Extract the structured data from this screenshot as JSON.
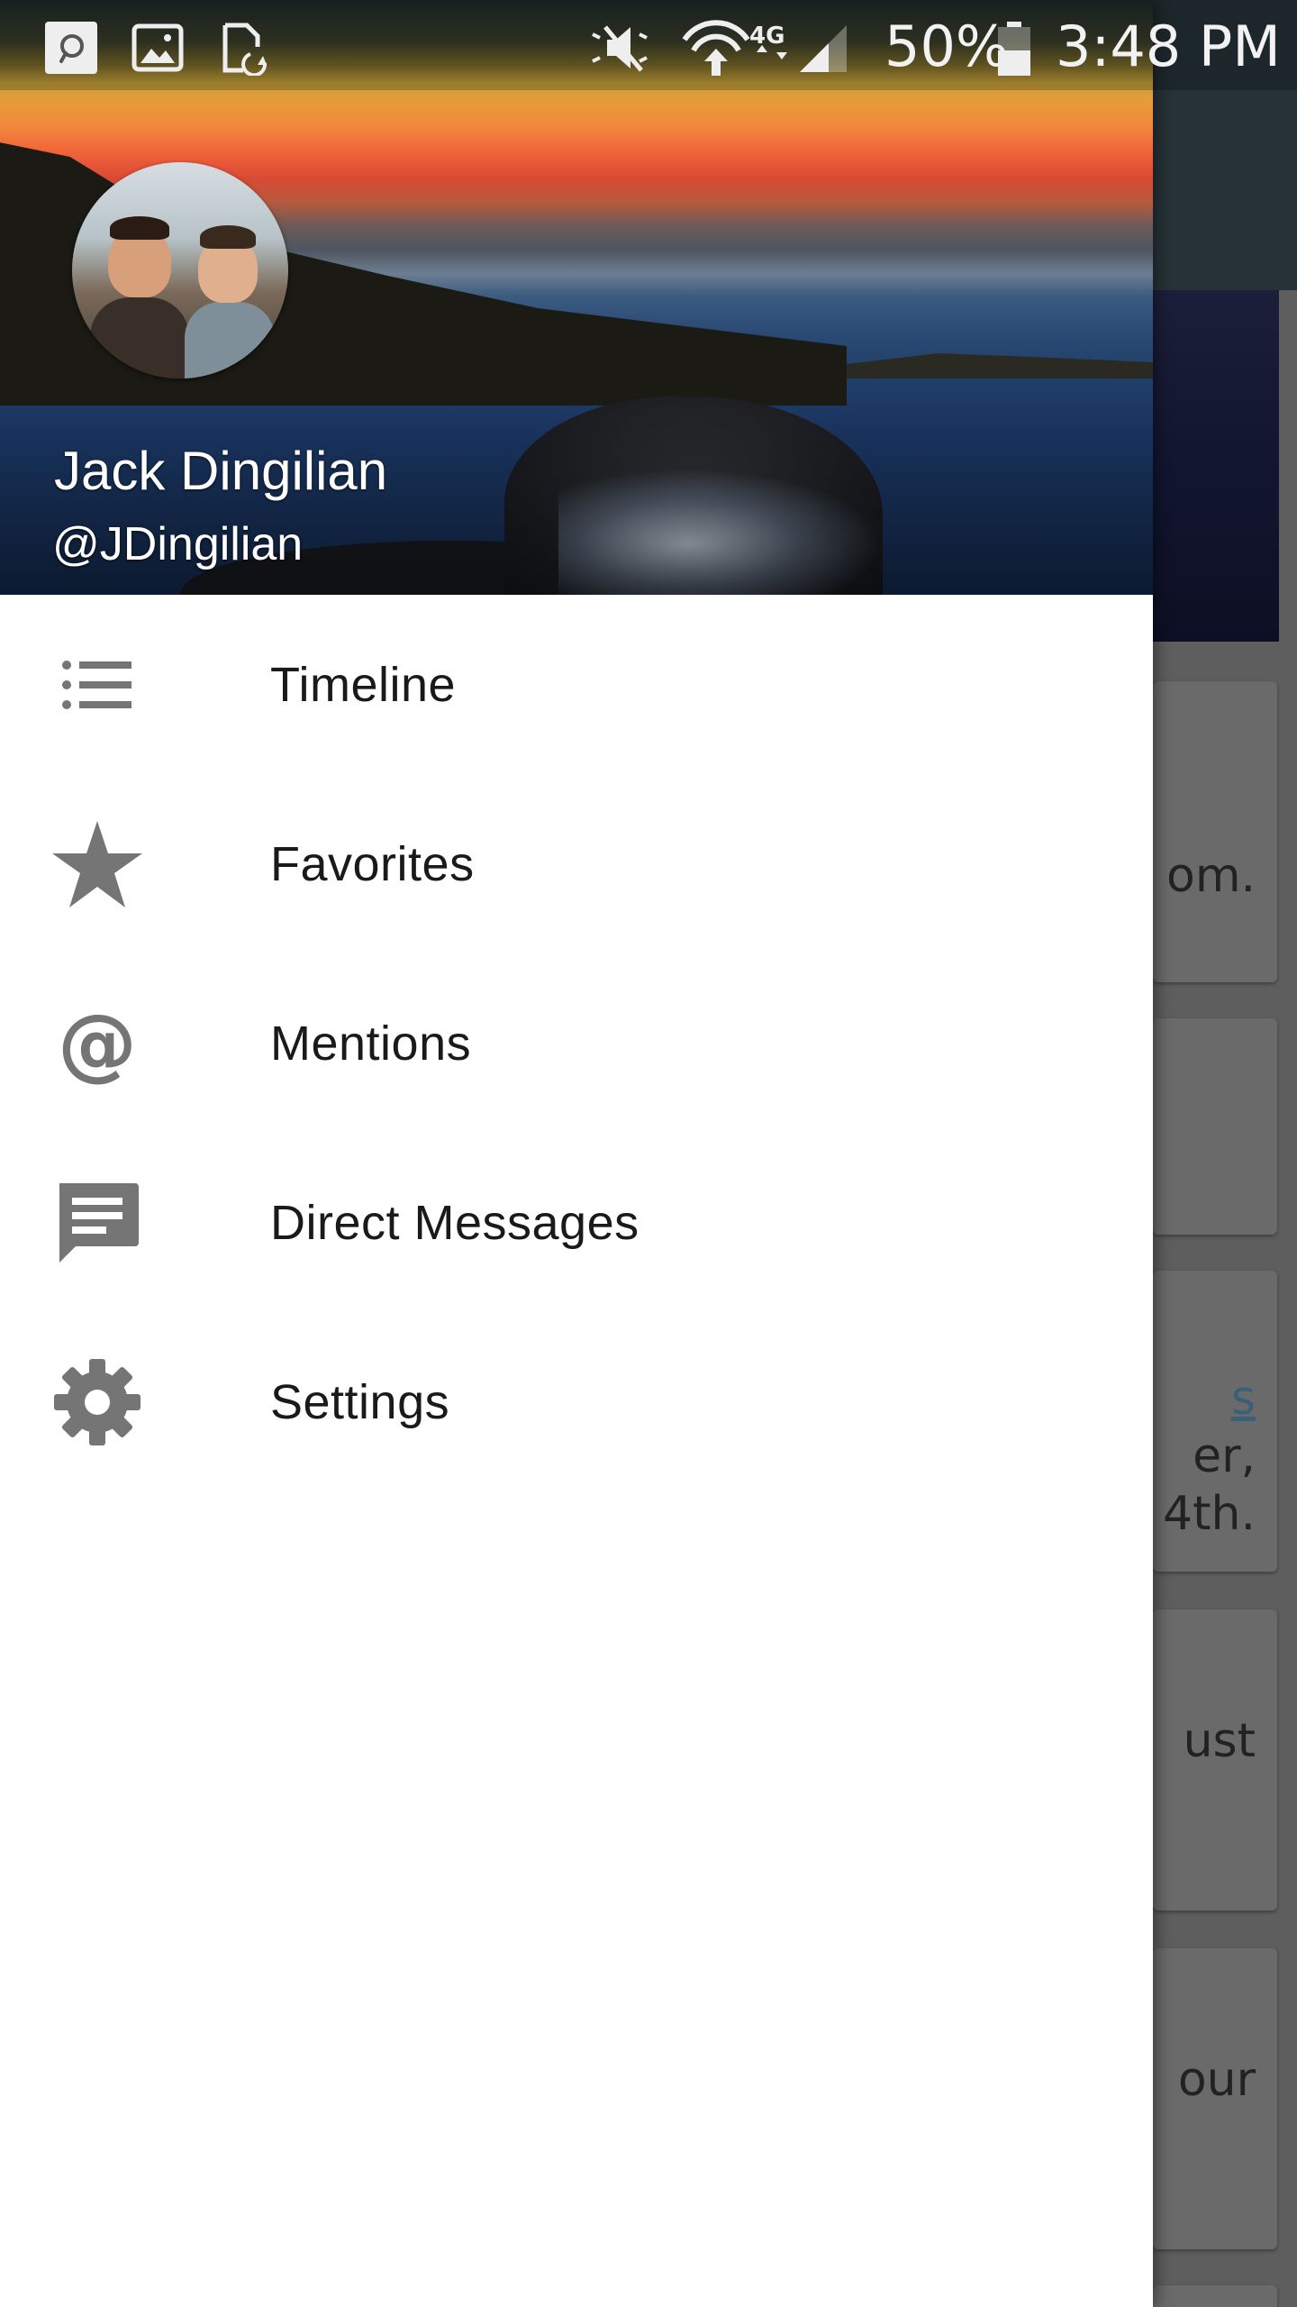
{
  "status_bar": {
    "battery": "50%",
    "time": "3:48 PM",
    "network": "4G"
  },
  "profile": {
    "name": "Jack Dingilian",
    "handle": "@JDingilian"
  },
  "menu": {
    "items": [
      {
        "label": "Timeline",
        "icon": "list-icon"
      },
      {
        "label": "Favorites",
        "icon": "star-icon"
      },
      {
        "label": "Mentions",
        "icon": "at-icon"
      },
      {
        "label": "Direct Messages",
        "icon": "message-icon"
      },
      {
        "label": "Settings",
        "icon": "gear-icon"
      }
    ]
  },
  "background_feed": {
    "fragments": [
      "om.",
      "s",
      "er,",
      "4th.",
      "ust",
      "our"
    ]
  },
  "colors": {
    "icon_gray": "#757575",
    "drawer_bg": "#ffffff",
    "scrim": "#5c5c5c",
    "toolbar": "#263238"
  }
}
